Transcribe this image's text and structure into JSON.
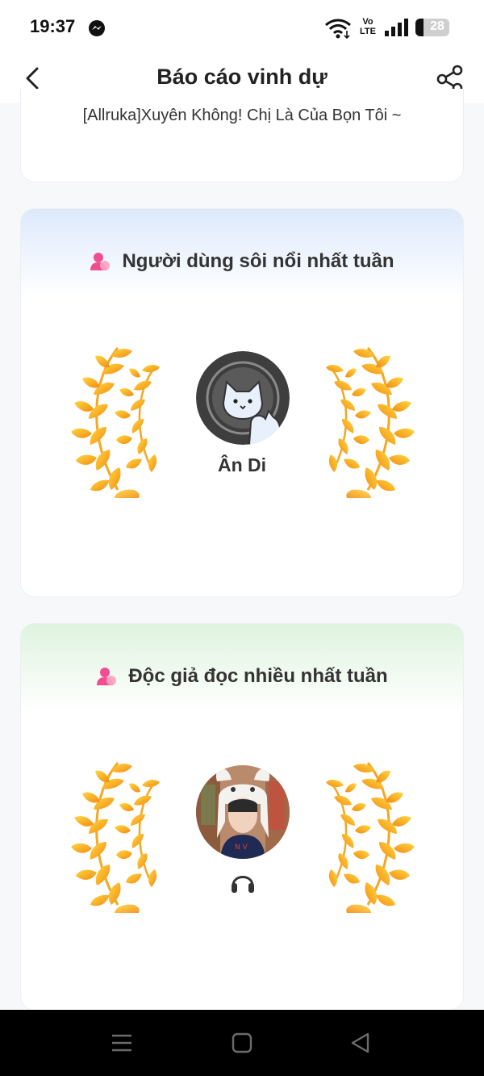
{
  "status_bar": {
    "time": "19:37",
    "network": "Vo LTE",
    "battery": "28",
    "icons": [
      "messenger-icon",
      "wifi-icon",
      "signal-icon",
      "battery-icon"
    ]
  },
  "header": {
    "title": "Báo cáo vinh dự",
    "back_icon": "chevron-left-icon",
    "share_icon": "share-icon"
  },
  "top_card": {
    "title": "[Allruka]Xuyên Không! Chị Là Của Bọn Tôi ~"
  },
  "active_user_card": {
    "title": "Người dùng sôi nổi nhất tuần",
    "user_name": "Ân Di",
    "accent": "#dde9fb"
  },
  "top_reader_card": {
    "title": "Độc giả đọc nhiều nhất tuần",
    "user_name": "",
    "badge_icon": "headphone-icon",
    "accent": "#dff3df"
  },
  "nav_bar": {
    "icons": [
      "menu-icon",
      "home-icon",
      "back-triangle-icon"
    ]
  },
  "colors": {
    "laurel_light": "#ffd23a",
    "laurel_dark": "#f7931e",
    "person_icon": "#ef4f8f"
  }
}
